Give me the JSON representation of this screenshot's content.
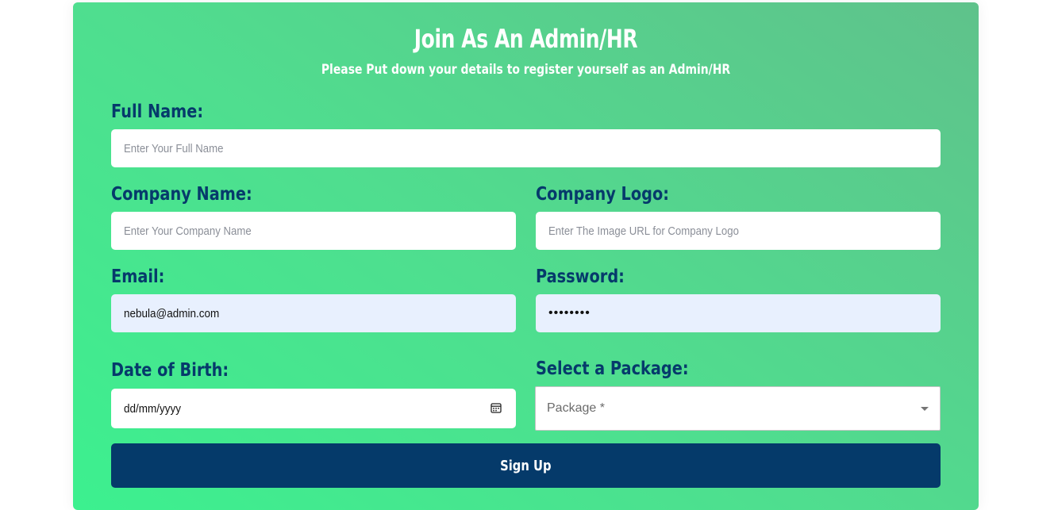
{
  "header": {
    "title": "Join As An Admin/HR",
    "subtitle": "Please Put down your details to register yourself as an Admin/HR"
  },
  "form": {
    "full_name": {
      "label": "Full Name:",
      "placeholder": "Enter Your Full Name"
    },
    "company_name": {
      "label": "Company Name:",
      "placeholder": "Enter Your Company Name"
    },
    "company_logo": {
      "label": "Company Logo:",
      "placeholder": "Enter The Image URL for Company Logo"
    },
    "email": {
      "label": "Email:",
      "value": "nebula@admin.com"
    },
    "password": {
      "label": "Password:",
      "masked_value": "••••••••"
    },
    "date_of_birth": {
      "label": "Date of Birth:",
      "placeholder": "dd/mm/yyyy",
      "icon": "calendar-icon"
    },
    "package": {
      "label": "Select a Package:",
      "placeholder": "Package *",
      "icon": "caret-down-icon"
    },
    "submit_label": "Sign Up"
  },
  "colors": {
    "gradient_start": "#3cf08f",
    "gradient_end": "#5fc28b",
    "label": "#063a6b",
    "button": "#053a6a",
    "autofill": "#e8f0fe"
  }
}
